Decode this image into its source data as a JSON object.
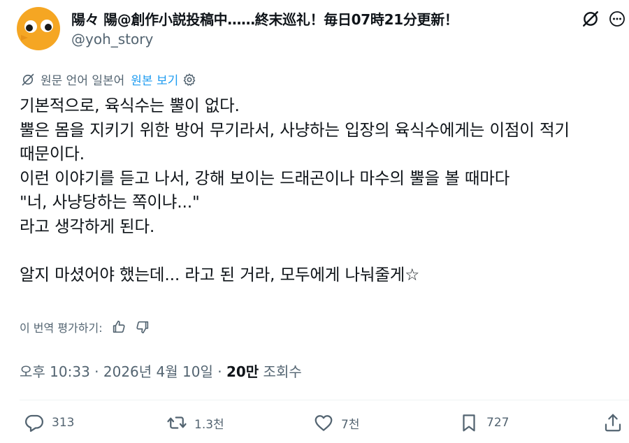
{
  "author": {
    "display_name": "陽々 陽@創作小説投稿中……終末巡礼！毎日07時21分更新！",
    "handle": "@yoh_story"
  },
  "translation": {
    "note": "원문 언어 일본어",
    "show_original": "원본 보기",
    "rate_prompt": "이 번역 평가하기:"
  },
  "post": {
    "lines": [
      "기본적으로, 육식수는 뿔이 없다.",
      "뿔은 몸을 지키기 위한 방어 무기라서, 사냥하는 입장의 육식수에게는 이점이 적기",
      "때문이다.",
      "이런 이야기를 듣고 나서, 강해 보이는 드래곤이나 마수의 뿔을 볼 때마다",
      "\"너, 사냥당하는 쪽이냐...\"",
      "라고 생각하게 된다.",
      "",
      "알지 마셨어야 했는데... 라고 된 거라, 모두에게 나눠줄게☆"
    ]
  },
  "meta": {
    "time": "오후 10:33",
    "date": "2026년 4월 10일",
    "views_count": "20만",
    "views_label": "조회수",
    "separator": "·"
  },
  "actions": {
    "replies": "313",
    "reposts": "1.3천",
    "likes": "7천",
    "bookmarks": "727"
  },
  "icons": {
    "avatar": "orange-bird-avatar",
    "grok": "grok-icon",
    "more": "more-icon",
    "translate": "translate-icon",
    "settings": "gear-icon",
    "thumbs_up": "thumbs-up-icon",
    "thumbs_down": "thumbs-down-icon",
    "reply": "reply-icon",
    "repost": "repost-icon",
    "like": "heart-icon",
    "bookmark": "bookmark-icon",
    "share": "share-icon"
  },
  "colors": {
    "text": "#0f1419",
    "secondary": "#536471",
    "link": "#1d9bf0",
    "avatar": "#f5a623"
  }
}
